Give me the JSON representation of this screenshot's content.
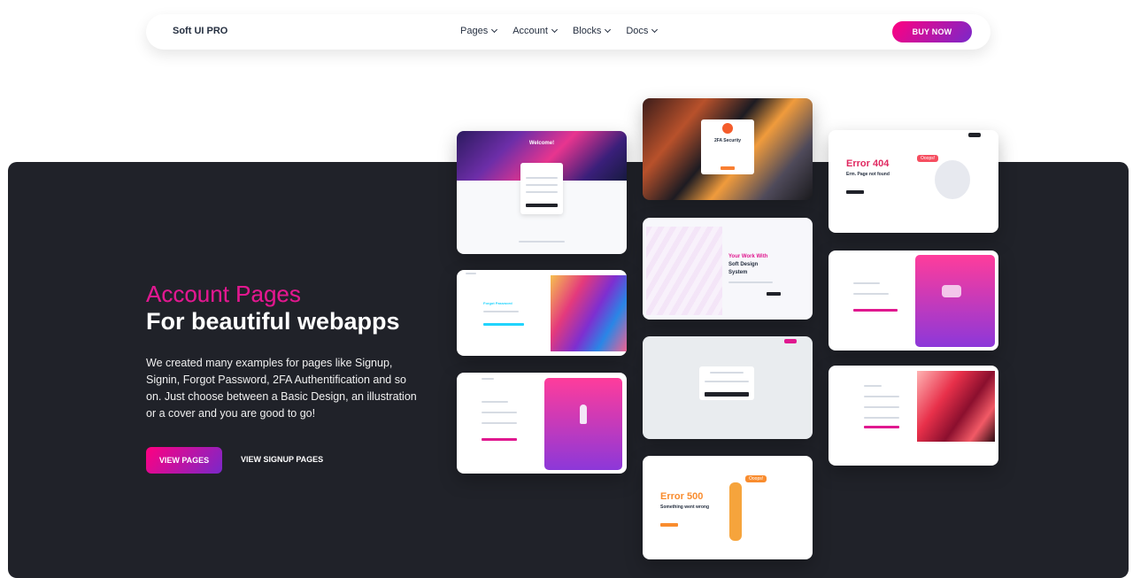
{
  "navbar": {
    "brand": "Soft UI PRO",
    "items": [
      {
        "label": "Pages"
      },
      {
        "label": "Account"
      },
      {
        "label": "Blocks"
      },
      {
        "label": "Docs"
      }
    ],
    "cta_label": "BUY NOW"
  },
  "hero": {
    "title_line1": "Account Pages",
    "title_line2": "For beautiful webapps",
    "description": "We created many examples for pages like Signup, Signin, Forgot Password, 2FA Authentification and so on. Just choose between a Basic Design, an illustration or a cover and you are good to go!",
    "primary_button": "VIEW PAGES",
    "secondary_button": "VIEW SIGNUP PAGES"
  },
  "previews": {
    "welcome_title": "Welcome!",
    "twofa_title": "2FA Security",
    "error404_title": "Error 404",
    "error404_sub": "Erm. Page not found",
    "error404_badge": "Ooops!",
    "soft_title_line1": "Your Work With",
    "soft_title_line2": "Soft Design",
    "soft_title_line3": "System",
    "forgot_title": "Forgot Password",
    "error500_title": "Error 500",
    "error500_sub": "Something went wrong",
    "error500_badge": "Ooops!"
  },
  "colors": {
    "accent_gradient_start": "#ff0080",
    "accent_gradient_end": "#7928ca",
    "dark_panel": "#202229"
  }
}
